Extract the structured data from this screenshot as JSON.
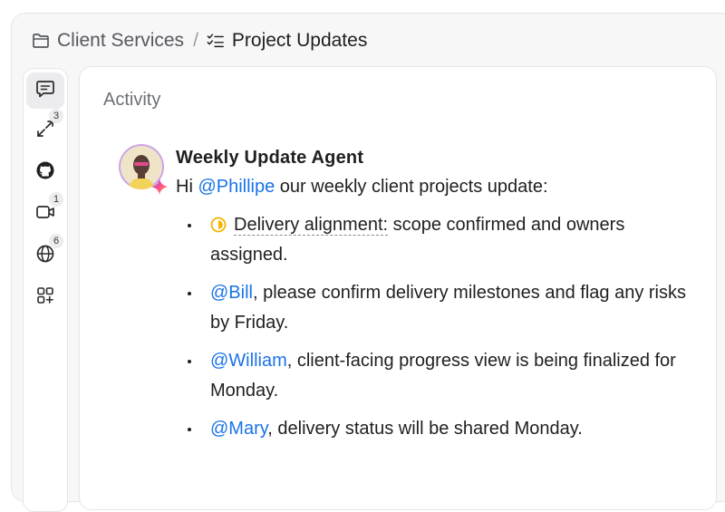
{
  "breadcrumb": {
    "folder_icon": "folder-icon",
    "folder_label": "Client Services",
    "separator": "/",
    "list_icon": "checklist-icon",
    "current_label": "Project Updates"
  },
  "rail": {
    "items": [
      {
        "icon": "comment-icon",
        "badge": ""
      },
      {
        "icon": "sync-arrows-icon",
        "badge": "3"
      },
      {
        "icon": "github-icon",
        "badge": ""
      },
      {
        "icon": "video-icon",
        "badge": "1"
      },
      {
        "icon": "globe-icon",
        "badge": "6"
      },
      {
        "icon": "add-app-icon",
        "badge": ""
      }
    ]
  },
  "panel": {
    "title": "Activity"
  },
  "message": {
    "author": "Weekly Update Agent",
    "intro_prefix": "Hi ",
    "intro_mention": "@Phillipe",
    "intro_suffix": " our weekly client projects update:",
    "bullets": [
      {
        "label": "Delivery alignment:",
        "text": " scope confirmed and owners assigned.",
        "status_color": "#f5b400"
      },
      {
        "mention": "@Bill",
        "text": ", please confirm delivery milestones and flag any risks by Friday."
      },
      {
        "mention": "@William",
        "text": ", client-facing progress view is being finalized for Monday."
      },
      {
        "mention": "@Mary",
        "text": ", delivery status will be shared Monday."
      }
    ]
  },
  "colors": {
    "mention": "#1a73e8",
    "status": "#f5b400"
  }
}
